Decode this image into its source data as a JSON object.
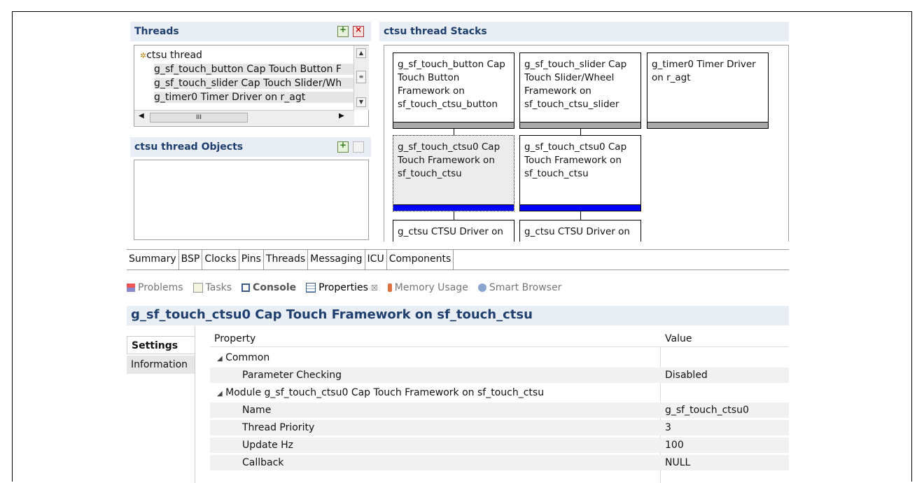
{
  "threads_panel": {
    "title": "Threads",
    "items": [
      {
        "label": "ctsu thread"
      },
      {
        "label": "g_sf_touch_button Cap Touch Button F"
      },
      {
        "label": "g_sf_touch_slider Cap Touch Slider/Wh"
      },
      {
        "label": "g_timer0 Timer Driver on r_agt"
      }
    ],
    "hscroll_grip": "III"
  },
  "objects_panel": {
    "title": "ctsu thread Objects"
  },
  "stacks_panel": {
    "title": "ctsu thread Stacks",
    "cards": [
      {
        "text": "g_sf_touch_button Cap Touch Button Framework on sf_touch_ctsu_button"
      },
      {
        "text": "g_sf_touch_slider Cap Touch Slider/Wheel Framework on sf_touch_ctsu_slider"
      },
      {
        "text": "g_timer0 Timer Driver on r_agt"
      },
      {
        "text": "g_sf_touch_ctsu0 Cap Touch Framework on sf_touch_ctsu"
      },
      {
        "text": "g_sf_touch_ctsu0 Cap Touch Framework on sf_touch_ctsu"
      },
      {
        "text": "g_ctsu CTSU Driver on"
      },
      {
        "text": "g_ctsu CTSU Driver on"
      }
    ],
    "colors": {
      "gray_bar": "#aaaaaa",
      "blue_bar": "#0000ff"
    }
  },
  "config_tabs": [
    "Summary",
    "BSP",
    "Clocks",
    "Pins",
    "Threads",
    "Messaging",
    "ICU",
    "Components"
  ],
  "active_config_tab": "Threads",
  "view_tabs": [
    {
      "label": "Problems",
      "icon": "problems-icon"
    },
    {
      "label": "Tasks",
      "icon": "tasks-icon"
    },
    {
      "label": "Console",
      "icon": "console-icon"
    },
    {
      "label": "Properties",
      "icon": "properties-icon"
    },
    {
      "label": "Memory Usage",
      "icon": "memory-icon"
    },
    {
      "label": "Smart Browser",
      "icon": "smart-browser-icon"
    }
  ],
  "properties_close_glyph": "☒",
  "properties": {
    "title": "g_sf_touch_ctsu0 Cap Touch Framework on sf_touch_ctsu",
    "side_tabs": [
      "Settings",
      "Information"
    ],
    "columns": [
      "Property",
      "Value"
    ],
    "rows": [
      {
        "property": "Common",
        "value": "",
        "expander": "◢",
        "level": 0
      },
      {
        "property": "Parameter Checking",
        "value": "Disabled",
        "level": 1
      },
      {
        "property": "Module g_sf_touch_ctsu0 Cap Touch Framework on sf_touch_ctsu",
        "value": "",
        "expander": "◢",
        "level": 0
      },
      {
        "property": "Name",
        "value": "g_sf_touch_ctsu0",
        "level": 1
      },
      {
        "property": "Thread Priority",
        "value": "3",
        "level": 1
      },
      {
        "property": "Update Hz",
        "value": "100",
        "level": 1
      },
      {
        "property": "Callback",
        "value": "NULL",
        "level": 1
      }
    ]
  }
}
